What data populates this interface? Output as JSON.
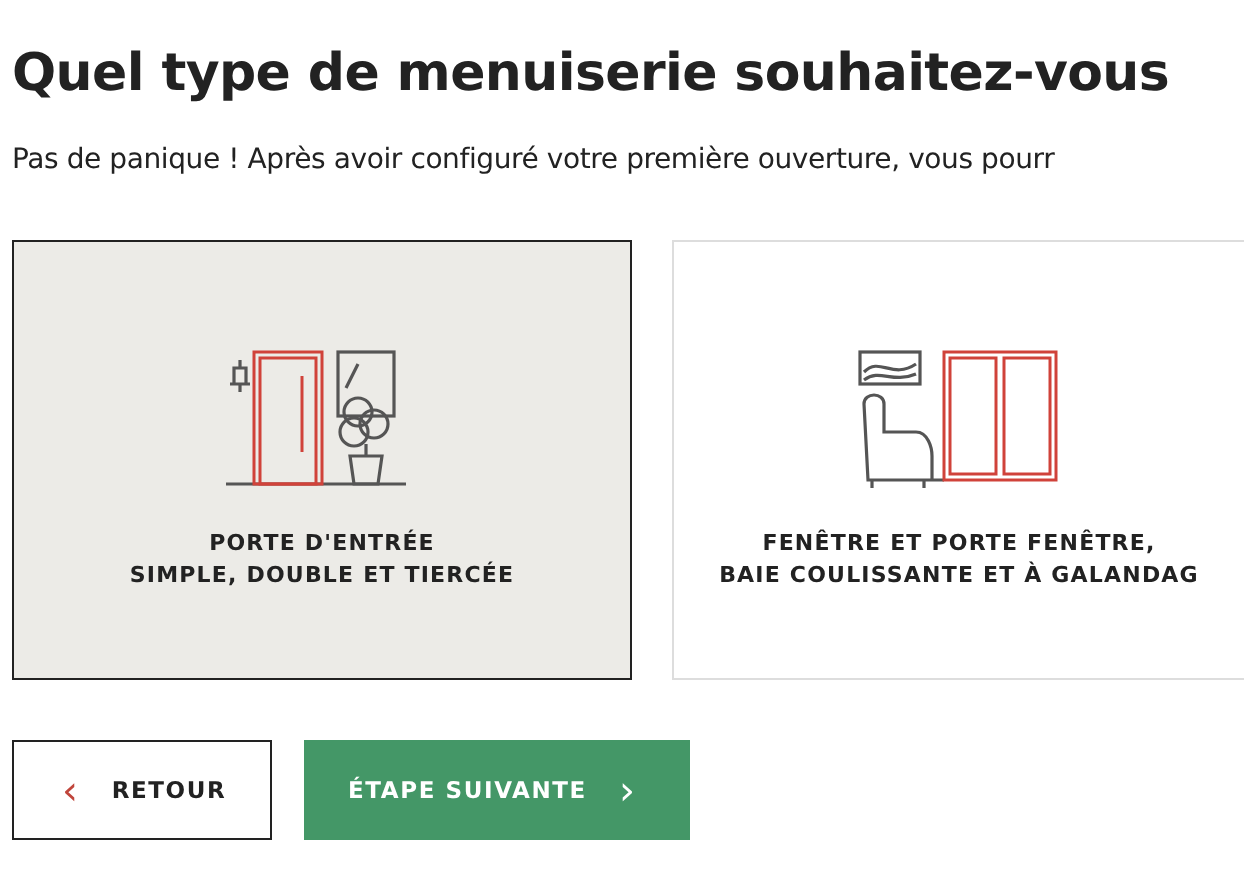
{
  "title": "Quel type de menuiserie souhaitez-vous",
  "subtitle": "Pas de panique ! Après avoir configuré votre première ouverture, vous pourr",
  "options": [
    {
      "kind": "door",
      "lines": [
        "PORTE D'ENTRÉE",
        "SIMPLE, DOUBLE ET TIERCÉE"
      ],
      "selected": true
    },
    {
      "kind": "window",
      "lines": [
        "FENÊTRE ET PORTE FENÊTRE,",
        "BAIE COULISSANTE ET À GALANDAG"
      ],
      "selected": false
    }
  ],
  "back_button": {
    "label": "RETOUR",
    "icon": "‹"
  },
  "next_button": {
    "label": "ÉTAPE SUIVANTE",
    "icon": "›"
  }
}
